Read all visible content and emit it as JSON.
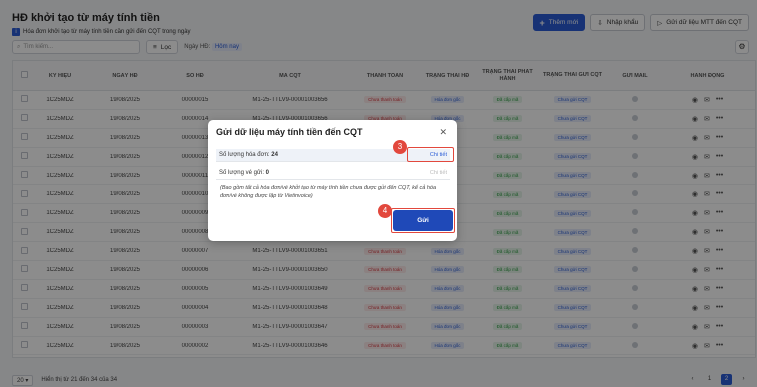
{
  "header": {
    "title": "HĐ khởi tạo từ máy tính tiền",
    "subtitle": "Hóa đơn khởi tạo từ máy tính tiền cần gửi đến CQT trong ngày"
  },
  "top_actions": {
    "add_new": "Thêm mới",
    "import": "Nhập khẩu",
    "send_data": "Gửi dữ liệu MTT đến CQT"
  },
  "toolbar": {
    "search_placeholder": "Tìm kiếm...",
    "filter_label": "Lọc",
    "date_filter_label": "Ngày HĐ:",
    "date_filter_value": "Hôm nay"
  },
  "table": {
    "columns": [
      "KÝ HIỆU",
      "NGÀY HĐ",
      "SỐ HĐ",
      "MÃ CQT",
      "THANH TOÁN",
      "TRẠNG THÁI HĐ",
      "TRẠNG THÁI PHÁT HÀNH",
      "TRẠNG THÁI GỬI CQT",
      "GỬI MAIL",
      "HÀNH ĐỘNG"
    ],
    "rows": [
      {
        "kh": "1C25MDZ",
        "date": "19/08/2025",
        "num": "00000015",
        "code": "M1-25-TTLV9-00001003656",
        "pay": "Chưa thanh toán",
        "status": "Hóa đơn gốc",
        "issue": "Đã cấp mã",
        "send": "Chưa gửi CQT"
      },
      {
        "kh": "1C25MDZ",
        "date": "19/08/2025",
        "num": "00000014",
        "code": "M1-25-TTLV9-00001003656",
        "pay": "Chưa thanh toán",
        "status": "Hóa đơn gốc",
        "issue": "Đã cấp mã",
        "send": "Chưa gửi CQT"
      },
      {
        "kh": "1C25MDZ",
        "date": "19/08/2025",
        "num": "00000013",
        "code": "",
        "pay": "",
        "status": "",
        "issue": "Đã cấp mã",
        "send": "Chưa gửi CQT"
      },
      {
        "kh": "1C25MDZ",
        "date": "19/08/2025",
        "num": "00000012",
        "code": "",
        "pay": "",
        "status": "",
        "issue": "Đã cấp mã",
        "send": "Chưa gửi CQT"
      },
      {
        "kh": "1C25MDZ",
        "date": "19/08/2025",
        "num": "00000011",
        "code": "",
        "pay": "",
        "status": "",
        "issue": "Đã cấp mã",
        "send": "Chưa gửi CQT"
      },
      {
        "kh": "1C25MDZ",
        "date": "19/08/2025",
        "num": "00000010",
        "code": "",
        "pay": "",
        "status": "",
        "issue": "Đã cấp mã",
        "send": "Chưa gửi CQT"
      },
      {
        "kh": "1C25MDZ",
        "date": "19/08/2025",
        "num": "00000009",
        "code": "",
        "pay": "",
        "status": "",
        "issue": "Đã cấp mã",
        "send": "Chưa gửi CQT"
      },
      {
        "kh": "1C25MDZ",
        "date": "19/08/2025",
        "num": "00000008",
        "code": "",
        "pay": "",
        "status": "",
        "issue": "Đã cấp mã",
        "send": "Chưa gửi CQT"
      },
      {
        "kh": "1C25MDZ",
        "date": "19/08/2025",
        "num": "00000007",
        "code": "M1-25-TTLV9-00001003651",
        "pay": "Chưa thanh toán",
        "status": "Hóa đơn gốc",
        "issue": "Đã cấp mã",
        "send": "Chưa gửi CQT"
      },
      {
        "kh": "1C25MDZ",
        "date": "19/08/2025",
        "num": "00000006",
        "code": "M1-25-TTLV9-00001003650",
        "pay": "Chưa thanh toán",
        "status": "Hóa đơn gốc",
        "issue": "Đã cấp mã",
        "send": "Chưa gửi CQT"
      },
      {
        "kh": "1C25MDZ",
        "date": "19/08/2025",
        "num": "00000005",
        "code": "M1-25-TTLV9-00001003649",
        "pay": "Chưa thanh toán",
        "status": "Hóa đơn gốc",
        "issue": "Đã cấp mã",
        "send": "Chưa gửi CQT"
      },
      {
        "kh": "1C25MDZ",
        "date": "19/08/2025",
        "num": "00000004",
        "code": "M1-25-TTLV9-00001003648",
        "pay": "Chưa thanh toán",
        "status": "Hóa đơn gốc",
        "issue": "Đã cấp mã",
        "send": "Chưa gửi CQT"
      },
      {
        "kh": "1C25MDZ",
        "date": "19/08/2025",
        "num": "00000003",
        "code": "M1-25-TTLV9-00001003647",
        "pay": "Chưa thanh toán",
        "status": "Hóa đơn gốc",
        "issue": "Đã cấp mã",
        "send": "Chưa gửi CQT"
      },
      {
        "kh": "1C25MDZ",
        "date": "19/08/2025",
        "num": "00000002",
        "code": "M1-25-TTLV9-00001003646",
        "pay": "Chưa thanh toán",
        "status": "Hóa đơn gốc",
        "issue": "Đã cấp mã",
        "send": "Chưa gửi CQT"
      }
    ]
  },
  "footer": {
    "page_size": "20",
    "range_text": "Hiển thị từ 21 đến 34 của 34",
    "pages": [
      "1",
      "2"
    ],
    "current_page": "2"
  },
  "modal": {
    "title": "Gửi dữ liệu máy tính tiền đến CQT",
    "row1_label": "Số lượng hóa đơn:",
    "row1_value": "24",
    "row1_link": "Chi tiết",
    "row2_label": "Số lượng vé gửi:",
    "row2_value": "0",
    "row2_link": "Chi tiết",
    "note": "(Bao gồm tất cả hóa đơn/vé khởi tạo từ máy tính tiền chưa được gửi đến CQT, kể cả hóa đơn/vé không được lập từ Vietinvoice)",
    "send_label": "Gửi",
    "callout_3": "3",
    "callout_4": "4"
  },
  "colors": {
    "primary": "#2a5cd6",
    "callout": "#e2483d"
  }
}
